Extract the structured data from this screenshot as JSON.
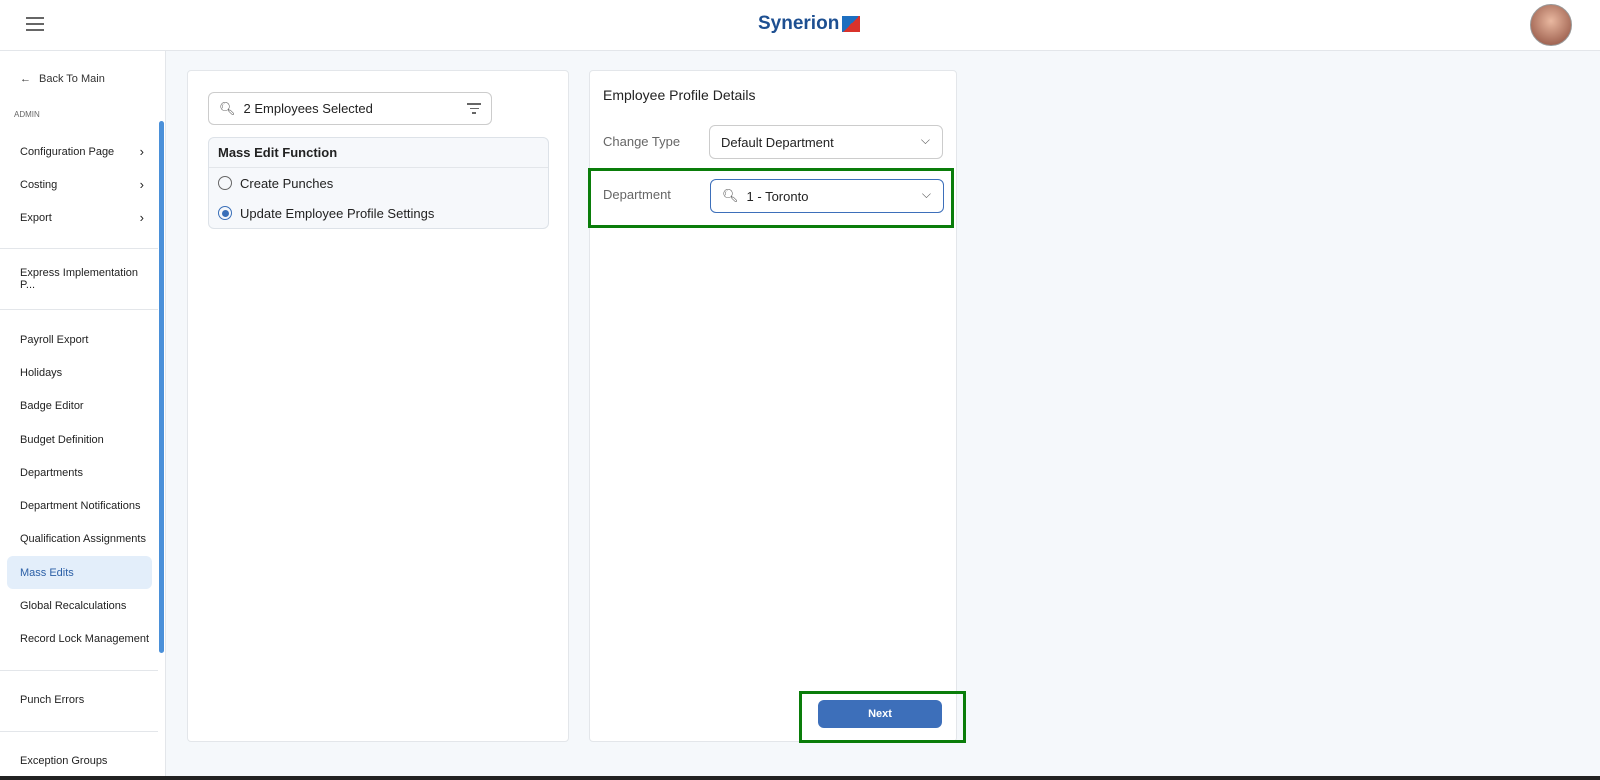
{
  "header": {
    "logo": "Synerion"
  },
  "sidebar": {
    "back": "Back To Main",
    "section": "ADMIN",
    "items": [
      {
        "label": "Configuration Page",
        "chevron": true
      },
      {
        "label": "Costing",
        "chevron": true
      },
      {
        "label": "Export",
        "chevron": true
      },
      {
        "label": "Express Implementation P..."
      },
      {
        "label": "Payroll Export"
      },
      {
        "label": "Holidays"
      },
      {
        "label": "Badge Editor"
      },
      {
        "label": "Budget Definition"
      },
      {
        "label": "Departments"
      },
      {
        "label": "Department Notifications"
      },
      {
        "label": "Qualification Assignments"
      },
      {
        "label": "Mass Edits",
        "active": true
      },
      {
        "label": "Global Recalculations"
      },
      {
        "label": "Record Lock Management"
      },
      {
        "label": "Punch Errors"
      },
      {
        "label": "Exception Groups"
      }
    ]
  },
  "left": {
    "search": "2 Employees Selected",
    "mass_edit_title": "Mass Edit Function",
    "options": [
      {
        "label": "Create Punches",
        "selected": false
      },
      {
        "label": "Update Employee Profile Settings",
        "selected": true
      }
    ]
  },
  "right": {
    "title": "Employee Profile Details",
    "change_type_label": "Change Type",
    "change_type_value": "Default Department",
    "department_label": "Department",
    "department_value": "1 - Toronto",
    "next": "Next"
  },
  "colors": {
    "accent": "#3d6fba",
    "highlight": "#0a7d0a"
  }
}
